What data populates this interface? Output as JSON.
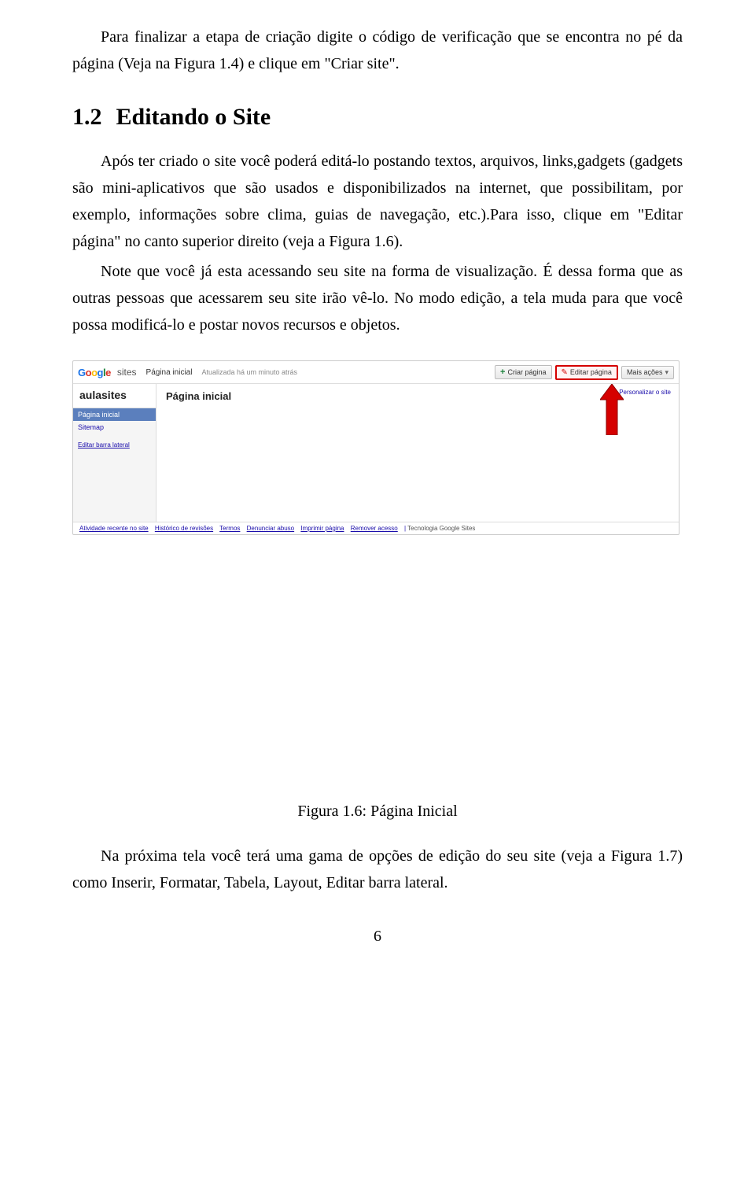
{
  "p1": "Para finalizar a etapa de criação digite o código de verificação que se encontra no pé da página (Veja na Figura 1.4) e clique em \"Criar site\".",
  "heading": {
    "num": "1.2",
    "title": "Editando o Site"
  },
  "p2": "Após ter criado o site você poderá editá-lo postando textos, arquivos, links,gadgets (gadgets são mini-aplicativos que são usados e disponibilizados na internet, que possibilitam, por exemplo, informações sobre clima, guias de navegação, etc.).Para isso, clique em \"Editar página\" no canto superior direito (veja a Figura 1.6).",
  "p3": "Note que você já esta acessando seu site na forma de visualização. É dessa forma que as outras pessoas que acessarem seu site irão vê-lo. No modo edição, a tela muda para que você possa modificá-lo e postar novos recursos e objetos.",
  "screenshot": {
    "brand_sites": "sites",
    "pagina_inicial": "Página inicial",
    "updated": "Atualizada há um minuto atrás",
    "criar_pagina": "Criar página",
    "editar_pagina": "Editar página",
    "mais_acoes": "Mais ações",
    "site_title": "aulasites",
    "nav_home": "Página inicial",
    "nav_sitemap": "Sitemap",
    "editar_barra": "Editar barra lateral",
    "personalizar": "Personalizar o site",
    "main_title": "Página inicial",
    "footer": {
      "atividade": "Atividade recente no site",
      "historico": "Histórico de revisões",
      "termos": "Termos",
      "denunciar": "Denunciar abuso",
      "imprimir": "Imprimir página",
      "remover": "Remover acesso",
      "tech": "Tecnologia Google Sites"
    }
  },
  "figure_caption": "Figura 1.6: Página Inicial",
  "p4": "Na próxima tela você terá uma gama de opções de edição do seu site (veja a Figura 1.7) como Inserir, Formatar, Tabela, Layout, Editar barra lateral.",
  "page_number": "6"
}
